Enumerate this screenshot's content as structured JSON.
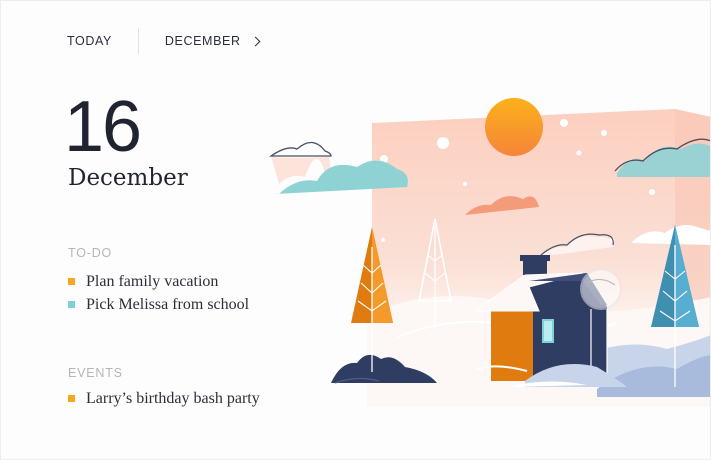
{
  "nav": {
    "today_label": "TODAY",
    "month_label": "DECEMBER"
  },
  "date": {
    "day": "16",
    "month": "December"
  },
  "todo": {
    "label": "TO-DO",
    "items": [
      {
        "text": "Plan family vacation",
        "color": "#f5a623"
      },
      {
        "text": "Pick Melissa from school",
        "color": "#7fd1d6"
      }
    ]
  },
  "events": {
    "label": "EVENTS",
    "items": [
      {
        "text": "Larry’s birthday bash party",
        "color": "#f5a623"
      }
    ]
  },
  "colors": {
    "text_dark": "#1f2430",
    "label_gray": "#b3b6bd",
    "accent_orange": "#f5a623",
    "accent_teal": "#7fd1d6",
    "sky_pink": "#fbd4c4"
  },
  "illustration": {
    "icon": "winter-house-illustration"
  }
}
